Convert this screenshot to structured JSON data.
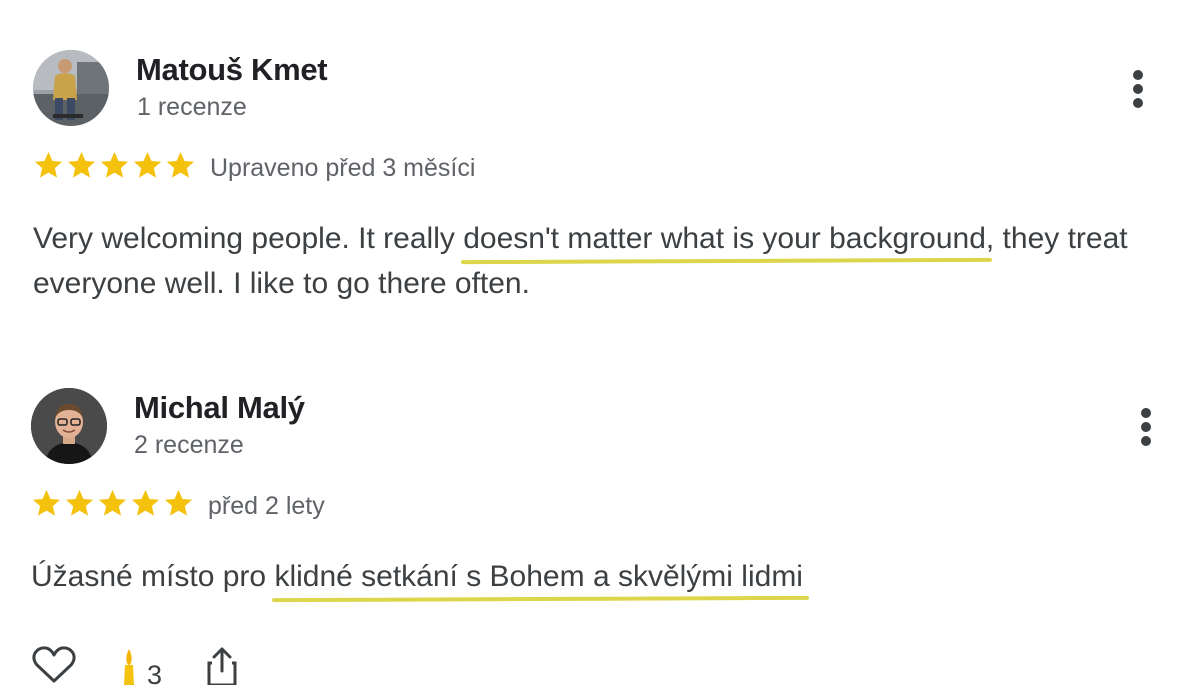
{
  "reviews": [
    {
      "author": "Matouš Kmet",
      "review_count": "1 recenze",
      "rating": 5,
      "date": "Upraveno před 3 měsíci",
      "text_before": "Very welcoming people. It really ",
      "text_highlight": "doesn't matter what is your background",
      "text_after": ", they treat everyone well. I like to go there often.",
      "avatar_icon": "person-photo-avatar",
      "menu_icon": "more-vert-icon"
    },
    {
      "author": "Michal Malý",
      "review_count": "2 recenze",
      "rating": 5,
      "date": "před 2 lety",
      "text_before": "Úžasné místo pro ",
      "text_highlight": "klidné setkání s Bohem a skvělými lidmi",
      "text_after": "",
      "avatar_icon": "person-photo-avatar",
      "menu_icon": "more-vert-icon",
      "actions": {
        "like_icon": "heart-icon",
        "reaction_icon": "candle-icon",
        "reaction_count": "3",
        "share_icon": "share-icon"
      }
    }
  ],
  "colors": {
    "star": "#f4c20d",
    "highlight_underline": "#ddd64a",
    "name": "#202124",
    "meta": "#5f6368",
    "text": "#3c4043"
  }
}
